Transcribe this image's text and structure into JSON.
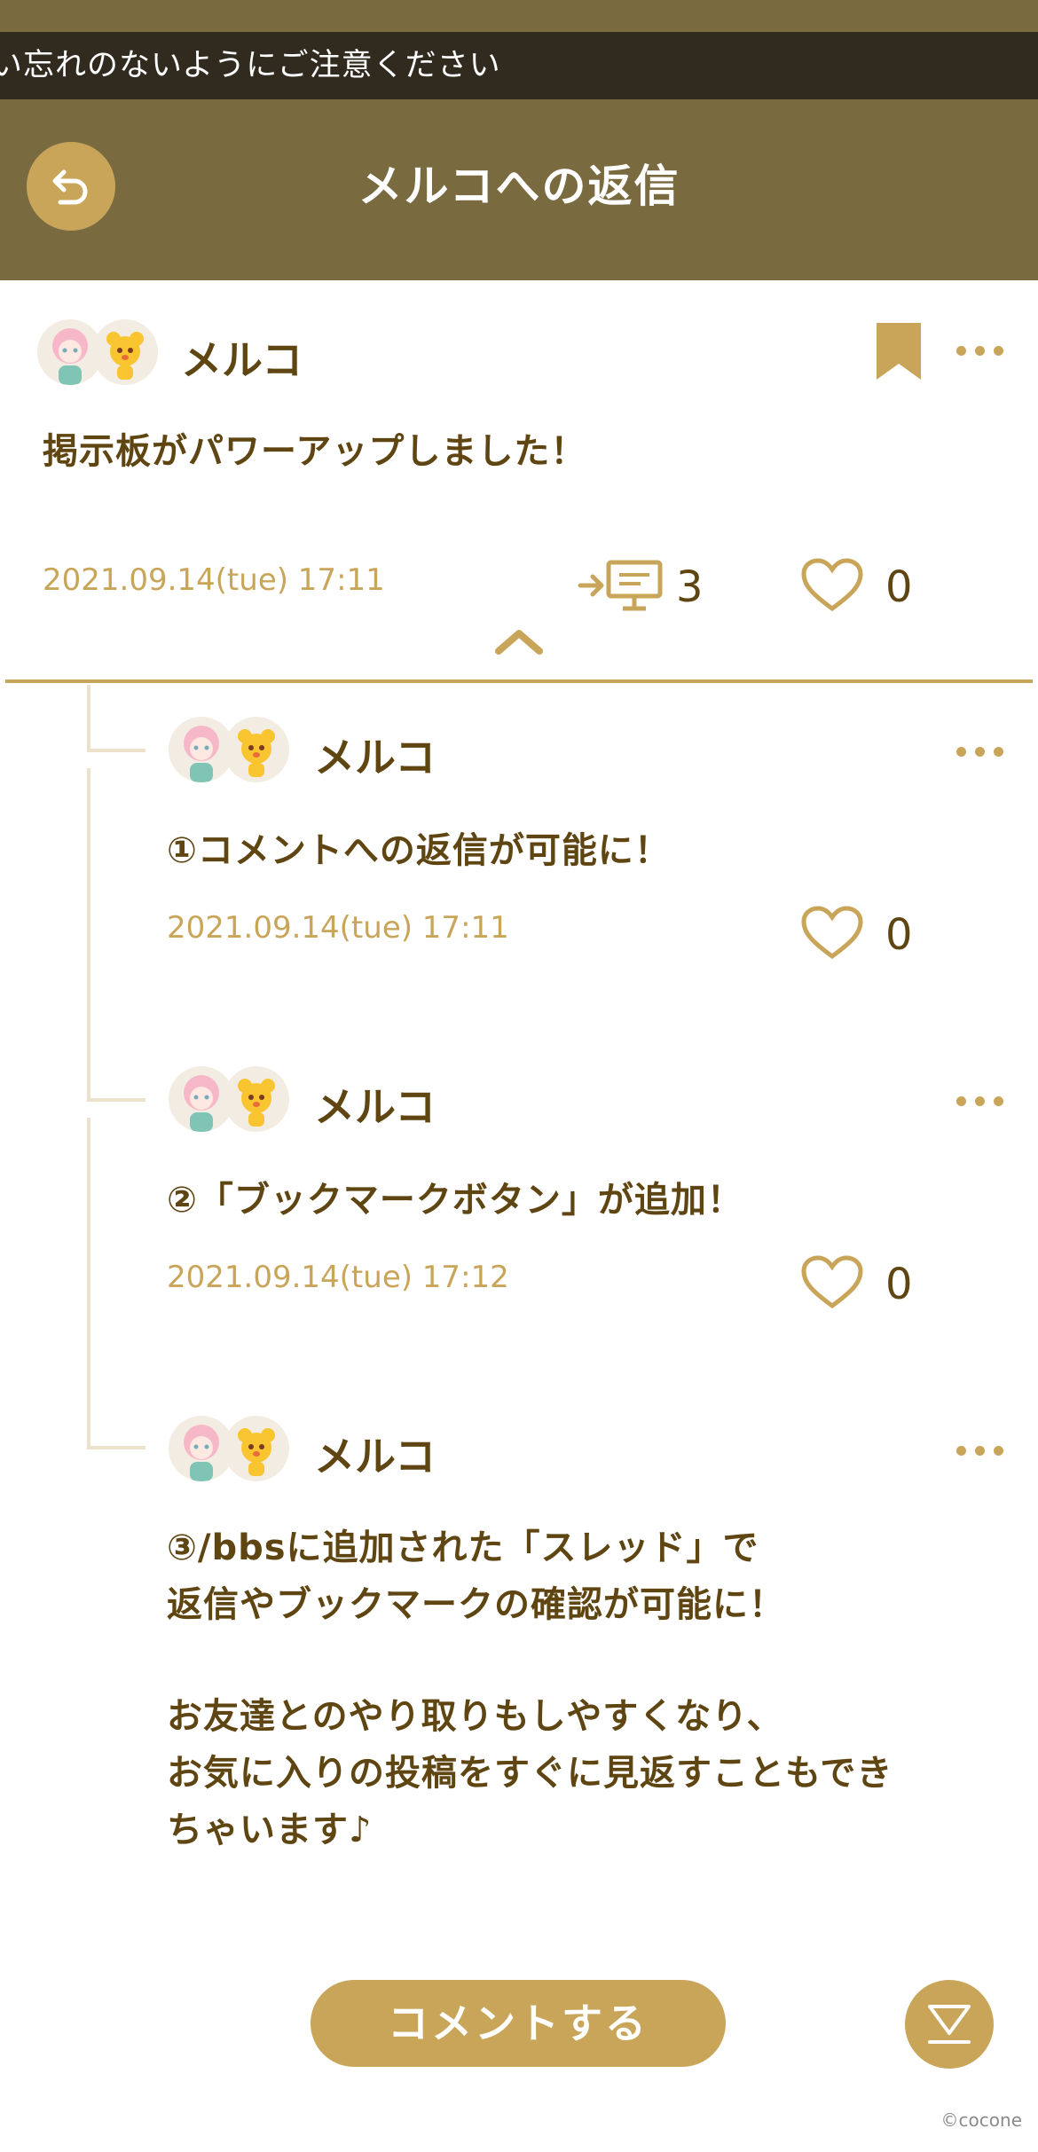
{
  "status": {
    "ticker_text": "い忘れのないようにご注意ください"
  },
  "header": {
    "title": "メルコへの返信",
    "back_icon": "back-arrow-icon"
  },
  "post": {
    "username": "メルコ",
    "text": "掲示板がパワーアップしました！",
    "timestamp": "2021.09.14(tue) 17:11",
    "reply_count": "3",
    "like_count": "0"
  },
  "replies": [
    {
      "username": "メルコ",
      "text": "①コメントへの返信が可能に！",
      "timestamp": "2021.09.14(tue) 17:11",
      "like_count": "0"
    },
    {
      "username": "メルコ",
      "text": "②「ブックマークボタン」が追加！",
      "timestamp": "2021.09.14(tue) 17:12",
      "like_count": "0"
    },
    {
      "username": "メルコ",
      "text_lines": [
        "③/bbsに追加された「スレッド」で",
        "返信やブックマークの確認が可能に！",
        "",
        "お友達とのやり取りもしやすくなり、",
        "お気に入りの投稿をすぐに見返すこともでき",
        "ちゃいます♪"
      ]
    }
  ],
  "footer": {
    "comment_button": "コメントする",
    "copyright": "©cocone"
  },
  "colors": {
    "header_bg": "#7a6a40",
    "accent": "#c9a55a",
    "text": "#5f4512",
    "ticker_bg": "#302a1f"
  }
}
